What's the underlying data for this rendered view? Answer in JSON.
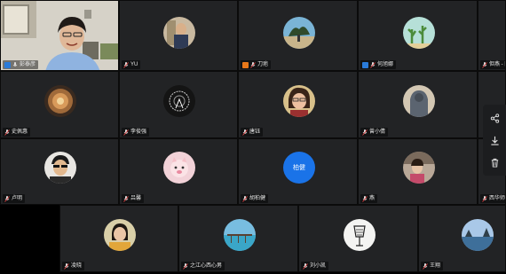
{
  "colors": {
    "tile_bg": "#222325",
    "host_badge": "#2a7bd9",
    "cohost_badge": "#e8781a",
    "blue_avatar": "#1a73e8",
    "icon": "#e6e6e6"
  },
  "participants": [
    {
      "name": "彭泰彦",
      "badge": "host",
      "mic": "on",
      "avatar": "video"
    },
    {
      "name": "YU",
      "mic": "muted",
      "avatar": "photo"
    },
    {
      "name": "刀疤",
      "badge": "cohost",
      "mic": "muted",
      "avatar": "photo"
    },
    {
      "name": "何旭娜",
      "badge": "host",
      "mic": "muted",
      "avatar": "photo"
    },
    {
      "name": "但燕 - 阿周",
      "mic": "muted",
      "avatar": "none"
    },
    {
      "name": "史佩惠",
      "mic": "muted",
      "avatar": "photo"
    },
    {
      "name": "李俊强",
      "mic": "muted",
      "avatar": "photo"
    },
    {
      "name": "唐钰",
      "mic": "muted",
      "avatar": "photo"
    },
    {
      "name": "曾小倩",
      "mic": "muted",
      "avatar": "photo"
    },
    {
      "name": "",
      "mic": "muted",
      "avatar": "none"
    },
    {
      "name": "卢明",
      "mic": "muted",
      "avatar": "photo"
    },
    {
      "name": "吕馨",
      "mic": "muted",
      "avatar": "photo"
    },
    {
      "name": "胡柏健",
      "mic": "muted",
      "avatar": "initials",
      "initials": "柏健"
    },
    {
      "name": "燕",
      "mic": "muted",
      "avatar": "photo"
    },
    {
      "name": "西华师范学院",
      "mic": "muted",
      "avatar": "none"
    },
    {
      "name": "凌晓",
      "mic": "muted",
      "avatar": "photo"
    },
    {
      "name": "之江心西心男",
      "mic": "muted",
      "avatar": "photo"
    },
    {
      "name": "刘小凯",
      "mic": "muted",
      "avatar": "photo"
    },
    {
      "name": "王翔",
      "mic": "muted",
      "avatar": "photo"
    }
  ],
  "sidebar": {
    "icons": [
      "share-icon",
      "download-icon",
      "trash-icon"
    ]
  }
}
